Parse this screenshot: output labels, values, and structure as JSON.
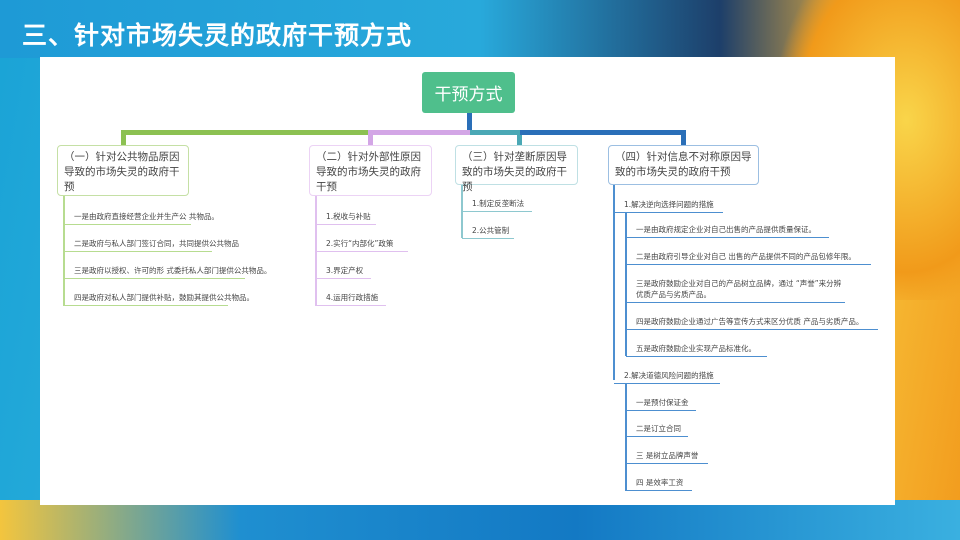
{
  "title": "三、针对市场失灵的政府干预方式",
  "root": "干预方式",
  "colors": {
    "green": "#8cc152",
    "purple": "#d3a6e6",
    "teal": "#4aa8b5",
    "blue": "#2a6fb8",
    "root": "#4fbf8c"
  },
  "branches": [
    {
      "label": "（一）针对公共物品原因导致的市场失灵的政府干预",
      "items": [
        "一是由政府直接经营企业并生产公 共物品。",
        "二是政府与私人部门签订合同，共同提供公共物品",
        "三是政府以授权、许可的形 式委托私人部门提供公共物品。",
        "四是政府对私人部门提供补贴，鼓励其提供公共物品。"
      ]
    },
    {
      "label": "（二）针对外部性原因导致的市场失灵的政府干预",
      "items": [
        "1.税收与补贴",
        "2.实行“内部化”政策",
        "3.界定产权",
        "4.运用行政措施"
      ]
    },
    {
      "label": "（三）针对垄断原因导致的市场失灵的政府干预",
      "items": [
        "1.制定反垄断法",
        "2.公共管制"
      ]
    },
    {
      "label": "（四）针对信息不对称原因导致的市场失灵的政府干预",
      "groups": [
        {
          "label": "1.解决逆向选择问题的措施",
          "items": [
            "一是由政府规定企业对自己出售的产品提供质量保证。",
            "二是由政府引导企业对自己 出售的产品提供不同的产品包修年限。",
            "三是政府鼓励企业对自己的产品树立品牌，通过 “声誉”来分辨优质产品与劣质产品。",
            "四是政府鼓励企业通过广告等宣传方式来区分优质 产品与劣质产品。",
            "五是政府鼓励企业实现产品标准化。"
          ]
        },
        {
          "label": "2.解决道德风险问题的措施",
          "items": [
            "一是预付保证金",
            "二是订立合同",
            "三 是树立品牌声誉",
            "四 是效率工资"
          ]
        }
      ]
    }
  ]
}
